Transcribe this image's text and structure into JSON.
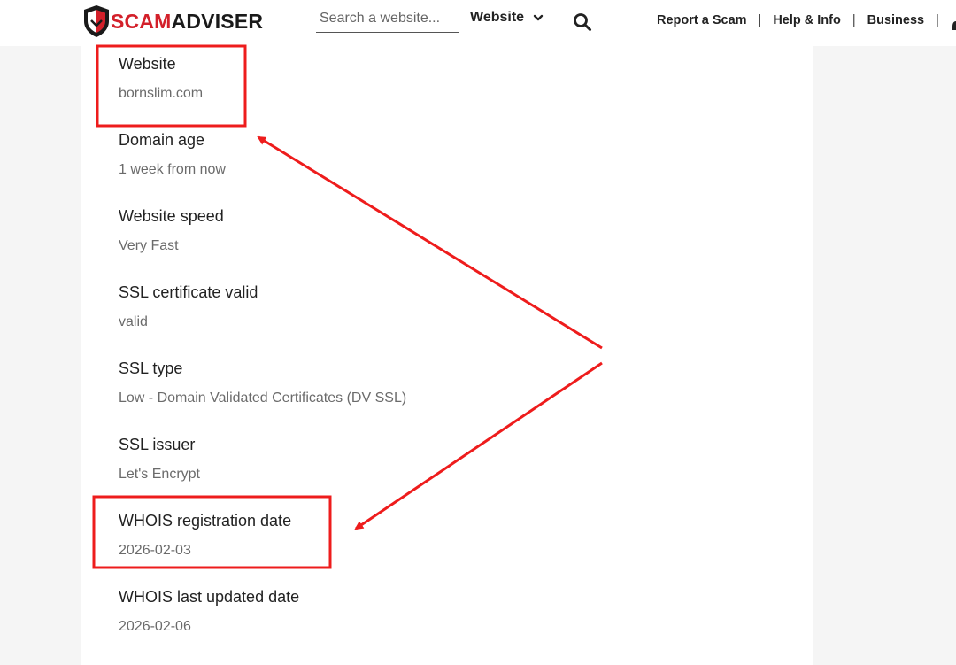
{
  "header": {
    "logo": {
      "text_scam": "SCAM",
      "text_adviser": "ADVISER"
    },
    "search": {
      "placeholder": "Search a website..."
    },
    "search_type": "Website",
    "nav": [
      {
        "label": "Report a Scam"
      },
      {
        "label": "Help & Info"
      },
      {
        "label": "Business"
      }
    ],
    "icons": {
      "logo": "shield-icon",
      "dropdown": "chevron-down-icon",
      "search": "search-icon"
    }
  },
  "details": [
    {
      "label": "Website",
      "value": "bornslim.com"
    },
    {
      "label": "Domain age",
      "value": "1 week from now"
    },
    {
      "label": "Website speed",
      "value": "Very Fast"
    },
    {
      "label": "SSL certificate valid",
      "value": "valid"
    },
    {
      "label": "SSL type",
      "value": "Low - Domain Validated Certificates (DV SSL)"
    },
    {
      "label": "SSL issuer",
      "value": "Let's Encrypt"
    },
    {
      "label": "WHOIS registration date",
      "value": "2026-02-03"
    },
    {
      "label": "WHOIS last updated date",
      "value": "2026-02-06"
    }
  ],
  "annotation": {
    "color": "#ee1c1c",
    "highlighted": [
      "Website",
      "WHOIS registration date"
    ]
  },
  "colors": {
    "brand_red": "#d3202a",
    "page_bg": "#f5f5f5",
    "label": "#222222",
    "value": "#6b6b6b"
  }
}
